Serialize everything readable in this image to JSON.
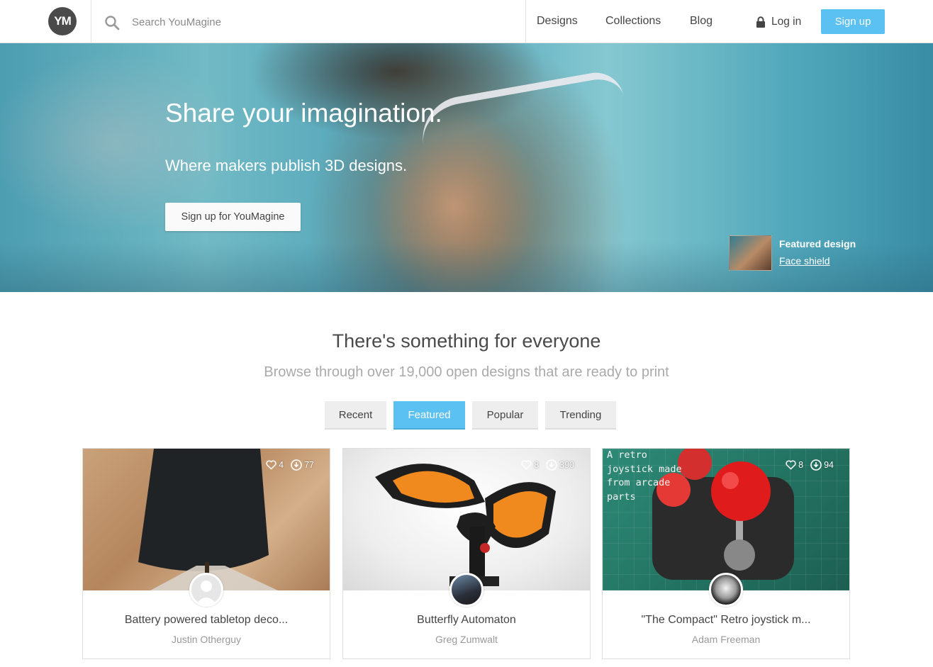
{
  "header": {
    "logo_text": "YM",
    "search_placeholder": "Search YouMagine",
    "nav": {
      "designs": "Designs",
      "collections": "Collections",
      "blog": "Blog"
    },
    "login": "Log in",
    "signup": "Sign up"
  },
  "hero": {
    "title": "Share your imagination.",
    "subtitle": "Where makers publish 3D designs.",
    "cta": "Sign up for YouMagine",
    "featured_label": "Featured design",
    "featured_name": "Face shield"
  },
  "section": {
    "title": "There's something for everyone",
    "subtitle": "Browse through over 19,000 open designs that are ready to print"
  },
  "tabs": [
    {
      "label": "Recent"
    },
    {
      "label": "Featured",
      "active": true
    },
    {
      "label": "Popular"
    },
    {
      "label": "Trending"
    }
  ],
  "cards": [
    {
      "title": "Battery powered tabletop deco...",
      "author": "Justin Otherguy",
      "likes": "4",
      "downloads": "77"
    },
    {
      "title": "Butterfly Automaton",
      "author": "Greg Zumwalt",
      "likes": "8",
      "downloads": "390"
    },
    {
      "title": "\"The Compact\" Retro joystick m...",
      "author": "Adam Freeman",
      "likes": "8",
      "downloads": "94",
      "image_caption": "A retro joystick made from arcade parts"
    }
  ],
  "colors": {
    "accent": "#5bc0f2",
    "logo_bg": "#4a4a4a"
  }
}
